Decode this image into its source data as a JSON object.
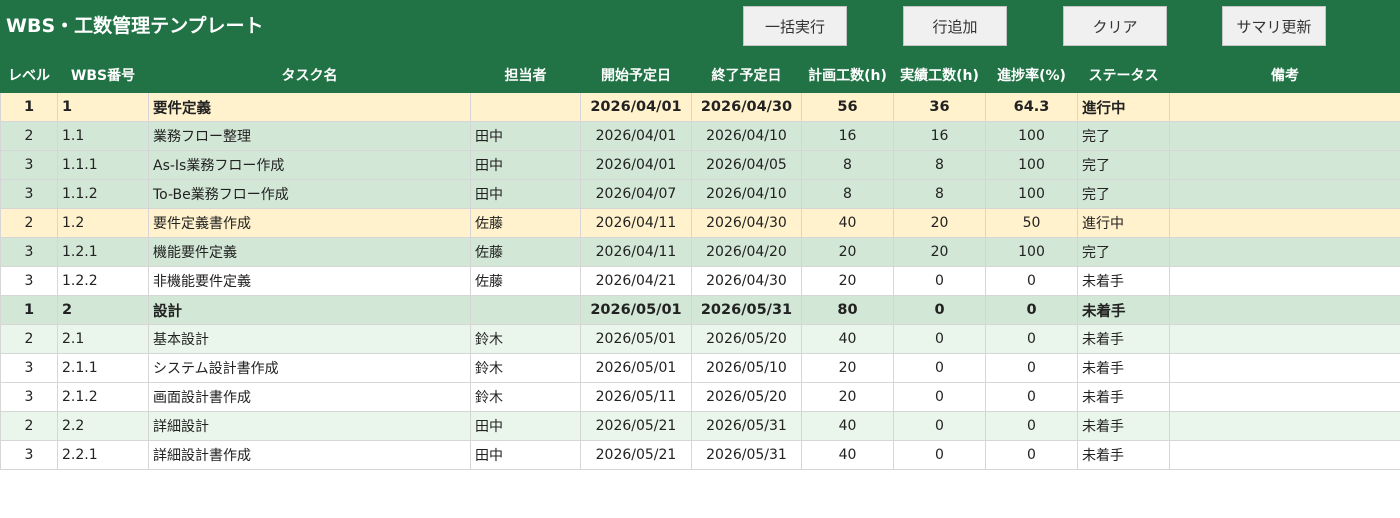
{
  "header": {
    "title": "WBS・工数管理テンプレート",
    "buttons": {
      "bulk_run": "一括実行",
      "add_row": "行追加",
      "clear": "クリア",
      "summary_update": "サマリ更新"
    }
  },
  "table": {
    "columns": {
      "level": "レベル",
      "wbs_no": "WBS番号",
      "task": "タスク名",
      "owner": "担当者",
      "start": "開始予定日",
      "end": "終了予定日",
      "planned": "計画工数(h)",
      "actual": "実績工数(h)",
      "progress": "進捗率(%)",
      "status": "ステータス",
      "notes": "備考"
    },
    "rows": [
      {
        "level": "1",
        "wbs_no": "1",
        "task": "要件定義",
        "owner": "",
        "start": "2026/04/01",
        "end": "2026/04/30",
        "planned": "56",
        "actual": "36",
        "progress": "64.3",
        "status": "進行中",
        "notes": ""
      },
      {
        "level": "2",
        "wbs_no": "1.1",
        "task": "業務フロー整理",
        "owner": "田中",
        "start": "2026/04/01",
        "end": "2026/04/10",
        "planned": "16",
        "actual": "16",
        "progress": "100",
        "status": "完了",
        "notes": ""
      },
      {
        "level": "3",
        "wbs_no": "1.1.1",
        "task": "As-Is業務フロー作成",
        "owner": "田中",
        "start": "2026/04/01",
        "end": "2026/04/05",
        "planned": "8",
        "actual": "8",
        "progress": "100",
        "status": "完了",
        "notes": ""
      },
      {
        "level": "3",
        "wbs_no": "1.1.2",
        "task": "To-Be業務フロー作成",
        "owner": "田中",
        "start": "2026/04/07",
        "end": "2026/04/10",
        "planned": "8",
        "actual": "8",
        "progress": "100",
        "status": "完了",
        "notes": ""
      },
      {
        "level": "2",
        "wbs_no": "1.2",
        "task": "要件定義書作成",
        "owner": "佐藤",
        "start": "2026/04/11",
        "end": "2026/04/30",
        "planned": "40",
        "actual": "20",
        "progress": "50",
        "status": "進行中",
        "notes": ""
      },
      {
        "level": "3",
        "wbs_no": "1.2.1",
        "task": "機能要件定義",
        "owner": "佐藤",
        "start": "2026/04/11",
        "end": "2026/04/20",
        "planned": "20",
        "actual": "20",
        "progress": "100",
        "status": "完了",
        "notes": ""
      },
      {
        "level": "3",
        "wbs_no": "1.2.2",
        "task": "非機能要件定義",
        "owner": "佐藤",
        "start": "2026/04/21",
        "end": "2026/04/30",
        "planned": "20",
        "actual": "0",
        "progress": "0",
        "status": "未着手",
        "notes": ""
      },
      {
        "level": "1",
        "wbs_no": "2",
        "task": "設計",
        "owner": "",
        "start": "2026/05/01",
        "end": "2026/05/31",
        "planned": "80",
        "actual": "0",
        "progress": "0",
        "status": "未着手",
        "notes": ""
      },
      {
        "level": "2",
        "wbs_no": "2.1",
        "task": "基本設計",
        "owner": "鈴木",
        "start": "2026/05/01",
        "end": "2026/05/20",
        "planned": "40",
        "actual": "0",
        "progress": "0",
        "status": "未着手",
        "notes": ""
      },
      {
        "level": "3",
        "wbs_no": "2.1.1",
        "task": "システム設計書作成",
        "owner": "鈴木",
        "start": "2026/05/01",
        "end": "2026/05/10",
        "planned": "20",
        "actual": "0",
        "progress": "0",
        "status": "未着手",
        "notes": ""
      },
      {
        "level": "3",
        "wbs_no": "2.1.2",
        "task": "画面設計書作成",
        "owner": "鈴木",
        "start": "2026/05/11",
        "end": "2026/05/20",
        "planned": "20",
        "actual": "0",
        "progress": "0",
        "status": "未着手",
        "notes": ""
      },
      {
        "level": "2",
        "wbs_no": "2.2",
        "task": "詳細設計",
        "owner": "田中",
        "start": "2026/05/21",
        "end": "2026/05/31",
        "planned": "40",
        "actual": "0",
        "progress": "0",
        "status": "未着手",
        "notes": ""
      },
      {
        "level": "3",
        "wbs_no": "2.2.1",
        "task": "詳細設計書作成",
        "owner": "田中",
        "start": "2026/05/21",
        "end": "2026/05/31",
        "planned": "40",
        "actual": "0",
        "progress": "0",
        "status": "未着手",
        "notes": ""
      }
    ]
  },
  "colors": {
    "header_green": "#217346",
    "in_progress_row": "#fff2cc",
    "done_or_level1_row": "#d2e7d5",
    "level2_not_started_row": "#eaf5ec",
    "default_row": "#ffffff"
  }
}
